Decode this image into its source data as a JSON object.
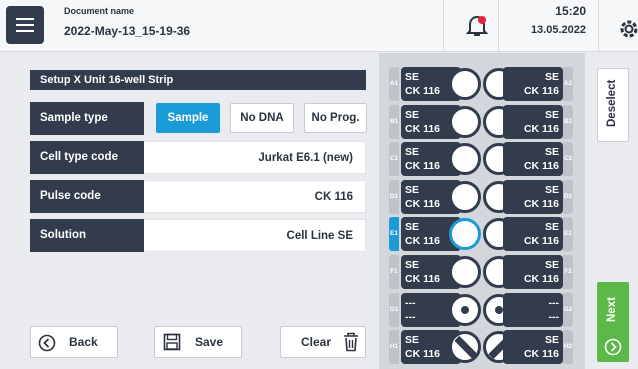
{
  "header": {
    "doc_label": "Document name",
    "doc_value": "2022-May-13_15-19-36",
    "time": "15:20",
    "date": "13.05.2022",
    "icons": [
      "menu-icon",
      "bell-alert-icon",
      "settings-icon"
    ]
  },
  "panel": {
    "title": "Setup X Unit 16-well Strip",
    "sample_type_label": "Sample type",
    "sample_options": [
      "Sample",
      "No DNA",
      "No Prog."
    ],
    "selected_sample_option": "Sample",
    "cell_type_label": "Cell type code",
    "cell_type_value": "Jurkat E6.1 (new)",
    "pulse_label": "Pulse code",
    "pulse_value": "CK 116",
    "solution_label": "Solution",
    "solution_value": "Cell Line SE"
  },
  "buttons": {
    "back": "Back",
    "save": "Save",
    "clear": "Clear",
    "deselect": "Deselect",
    "next": "Next"
  },
  "strip": {
    "selected_well": "E1",
    "rows": [
      {
        "left_id": "A1",
        "right_id": "A2",
        "solution_left": "SE",
        "code_left": "CK 116",
        "solution_right": "SE",
        "code_right": "CK 116",
        "well_state": "empty"
      },
      {
        "left_id": "B1",
        "right_id": "B2",
        "solution_left": "SE",
        "code_left": "CK 116",
        "solution_right": "SE",
        "code_right": "CK 116",
        "well_state": "empty"
      },
      {
        "left_id": "C1",
        "right_id": "C2",
        "solution_left": "SE",
        "code_left": "CK 116",
        "solution_right": "SE",
        "code_right": "CK 116",
        "well_state": "empty"
      },
      {
        "left_id": "D1",
        "right_id": "D2",
        "solution_left": "SE",
        "code_left": "CK 116",
        "solution_right": "SE",
        "code_right": "CK 116",
        "well_state": "empty"
      },
      {
        "left_id": "E1",
        "right_id": "E2",
        "solution_left": "SE",
        "code_left": "CK 116",
        "solution_right": "SE",
        "code_right": "CK 116",
        "well_state": "empty"
      },
      {
        "left_id": "F1",
        "right_id": "F2",
        "solution_left": "SE",
        "code_left": "CK 116",
        "solution_right": "SE",
        "code_right": "CK 116",
        "well_state": "empty"
      },
      {
        "left_id": "G1",
        "right_id": "G2",
        "solution_left": "---",
        "code_left": "---",
        "solution_right": "---",
        "code_right": "---",
        "well_state": "dot"
      },
      {
        "left_id": "H1",
        "right_id": "H2",
        "solution_left": "SE",
        "code_left": "CK 116",
        "solution_right": "SE",
        "code_right": "CK 116",
        "well_state": "slash"
      }
    ]
  },
  "colors": {
    "dark": "#323c4c",
    "accent": "#1a9ad6",
    "next_green": "#5cb848",
    "alert_red": "#e5213b"
  }
}
